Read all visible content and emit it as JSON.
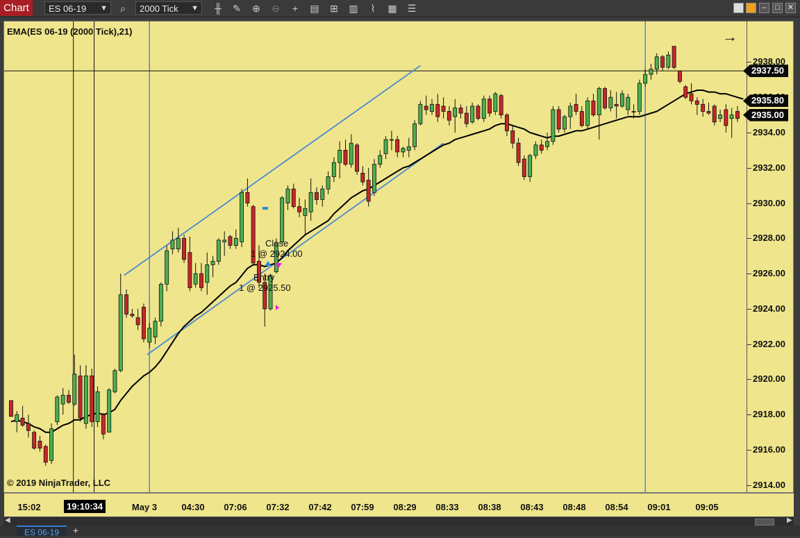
{
  "toolbar": {
    "chart_tab": "Chart",
    "instrument": "ES 06-19",
    "interval": "2000 Tick",
    "icons": [
      "search-icon",
      "bar-type-icon",
      "pencil-icon",
      "zoom-in-icon",
      "zoom-out-icon",
      "crosshair-icon",
      "properties-icon",
      "strategies-icon",
      "indicators-icon",
      "chart-trader-icon",
      "templates-icon",
      "list-icon"
    ]
  },
  "window": {
    "buttons": [
      "minimize",
      "maximize",
      "close"
    ]
  },
  "indicator_label": "EMA(ES 06-19 (2000 Tick),21)",
  "copyright": "© 2019 NinjaTrader, LLC",
  "price_markers": [
    {
      "label": "2937.50",
      "value": 2937.5
    },
    {
      "label": "2935.80",
      "value": 2935.8
    },
    {
      "label": "2935.00",
      "value": 2935.0
    }
  ],
  "annotations": {
    "close_line1": "Close",
    "close_line2": "1 @ 2924.00",
    "entry_line1": "Entry",
    "entry_line2": "1 @ 2925.50"
  },
  "bottom_tab": "ES 06-19",
  "add_tab": "+",
  "chart_data": {
    "type": "candlestick",
    "y_labels": [
      "2938.00",
      "2936.00",
      "2934.00",
      "2932.00",
      "2930.00",
      "2928.00",
      "2926.00",
      "2924.00",
      "2922.00",
      "2920.00",
      "2918.00",
      "2916.00",
      "2914.00"
    ],
    "ylim": [
      2913.6,
      2940.3
    ],
    "x_labels": [
      "15:02",
      "19:10:34",
      "May 3",
      "04:30",
      "07:06",
      "07:32",
      "07:42",
      "07:59",
      "08:29",
      "08:33",
      "08:38",
      "08:43",
      "08:48",
      "08:54",
      "09:01",
      "09:05"
    ],
    "highlighted_x_label": "19:10:34",
    "candles": [
      {
        "o": 2918.8,
        "h": 2918.8,
        "l": 2917.9,
        "c": 2917.9
      },
      {
        "o": 2917.6,
        "h": 2918.2,
        "l": 2917.0,
        "c": 2918.0
      },
      {
        "o": 2917.8,
        "h": 2918.5,
        "l": 2917.3,
        "c": 2917.4
      },
      {
        "o": 2917.5,
        "h": 2918.0,
        "l": 2916.7,
        "c": 2917.1
      },
      {
        "o": 2917.0,
        "h": 2917.1,
        "l": 2916.0,
        "c": 2916.1
      },
      {
        "o": 2916.5,
        "h": 2916.8,
        "l": 2915.9,
        "c": 2916.1
      },
      {
        "o": 2916.2,
        "h": 2916.3,
        "l": 2915.1,
        "c": 2915.3
      },
      {
        "o": 2915.4,
        "h": 2917.5,
        "l": 2915.2,
        "c": 2917.2
      },
      {
        "o": 2917.6,
        "h": 2919.1,
        "l": 2917.4,
        "c": 2919.0
      },
      {
        "o": 2918.6,
        "h": 2919.5,
        "l": 2918.0,
        "c": 2919.1
      },
      {
        "o": 2919.1,
        "h": 2919.4,
        "l": 2918.6,
        "c": 2918.7
      },
      {
        "o": 2918.6,
        "h": 2921.4,
        "l": 2918.5,
        "c": 2920.3
      },
      {
        "o": 2920.2,
        "h": 2920.8,
        "l": 2917.6,
        "c": 2917.8
      },
      {
        "o": 2917.5,
        "h": 2920.8,
        "l": 2917.2,
        "c": 2920.2
      },
      {
        "o": 2920.2,
        "h": 2920.6,
        "l": 2917.3,
        "c": 2917.6
      },
      {
        "o": 2917.6,
        "h": 2919.6,
        "l": 2917.3,
        "c": 2919.3
      },
      {
        "o": 2918.0,
        "h": 2918.1,
        "l": 2916.6,
        "c": 2916.9
      },
      {
        "o": 2917.0,
        "h": 2919.5,
        "l": 2917.0,
        "c": 2919.4
      },
      {
        "o": 2919.3,
        "h": 2920.6,
        "l": 2919.2,
        "c": 2920.5
      },
      {
        "o": 2920.5,
        "h": 2926.0,
        "l": 2920.4,
        "c": 2924.8
      },
      {
        "o": 2924.8,
        "h": 2925.1,
        "l": 2923.5,
        "c": 2923.7
      },
      {
        "o": 2923.7,
        "h": 2924.0,
        "l": 2923.5,
        "c": 2923.6
      },
      {
        "o": 2923.5,
        "h": 2924.0,
        "l": 2922.8,
        "c": 2923.1
      },
      {
        "o": 2924.1,
        "h": 2924.3,
        "l": 2922.1,
        "c": 2922.3
      },
      {
        "o": 2922.1,
        "h": 2923.2,
        "l": 2921.8,
        "c": 2922.9
      },
      {
        "o": 2922.4,
        "h": 2923.5,
        "l": 2922.0,
        "c": 2923.3
      },
      {
        "o": 2923.3,
        "h": 2925.5,
        "l": 2923.0,
        "c": 2925.4
      },
      {
        "o": 2925.4,
        "h": 2927.6,
        "l": 2925.0,
        "c": 2927.3
      },
      {
        "o": 2927.4,
        "h": 2928.4,
        "l": 2927.1,
        "c": 2927.9
      },
      {
        "o": 2927.4,
        "h": 2928.6,
        "l": 2927.2,
        "c": 2928.0
      },
      {
        "o": 2928.0,
        "h": 2928.2,
        "l": 2926.6,
        "c": 2926.8
      },
      {
        "o": 2927.2,
        "h": 2928.1,
        "l": 2925.0,
        "c": 2925.2
      },
      {
        "o": 2925.4,
        "h": 2926.6,
        "l": 2925.2,
        "c": 2926.0
      },
      {
        "o": 2926.0,
        "h": 2926.6,
        "l": 2925.0,
        "c": 2925.2
      },
      {
        "o": 2925.5,
        "h": 2927.2,
        "l": 2924.8,
        "c": 2926.5
      },
      {
        "o": 2926.5,
        "h": 2927.0,
        "l": 2925.8,
        "c": 2926.7
      },
      {
        "o": 2926.7,
        "h": 2928.0,
        "l": 2926.5,
        "c": 2927.9
      },
      {
        "o": 2927.8,
        "h": 2928.4,
        "l": 2927.0,
        "c": 2927.9
      },
      {
        "o": 2928.1,
        "h": 2928.2,
        "l": 2927.4,
        "c": 2927.6
      },
      {
        "o": 2927.6,
        "h": 2928.5,
        "l": 2927.4,
        "c": 2928.0
      },
      {
        "o": 2927.8,
        "h": 2930.8,
        "l": 2927.5,
        "c": 2930.6
      },
      {
        "o": 2930.6,
        "h": 2931.4,
        "l": 2929.8,
        "c": 2930.0
      },
      {
        "o": 2929.8,
        "h": 2929.9,
        "l": 2926.5,
        "c": 2926.6
      },
      {
        "o": 2926.7,
        "h": 2927.6,
        "l": 2925.2,
        "c": 2925.5
      },
      {
        "o": 2925.5,
        "h": 2926.0,
        "l": 2923.0,
        "c": 2924.0
      },
      {
        "o": 2924.0,
        "h": 2926.0,
        "l": 2923.9,
        "c": 2925.9
      },
      {
        "o": 2926.1,
        "h": 2928.0,
        "l": 2926.0,
        "c": 2927.7
      },
      {
        "o": 2927.8,
        "h": 2930.4,
        "l": 2927.7,
        "c": 2930.3
      },
      {
        "o": 2930.0,
        "h": 2931.0,
        "l": 2929.6,
        "c": 2930.8
      },
      {
        "o": 2930.8,
        "h": 2931.1,
        "l": 2929.7,
        "c": 2929.8
      },
      {
        "o": 2929.8,
        "h": 2930.3,
        "l": 2929.2,
        "c": 2929.5
      },
      {
        "o": 2929.3,
        "h": 2930.2,
        "l": 2928.2,
        "c": 2929.7
      },
      {
        "o": 2929.5,
        "h": 2931.4,
        "l": 2929.0,
        "c": 2930.6
      },
      {
        "o": 2930.6,
        "h": 2930.9,
        "l": 2929.9,
        "c": 2930.2
      },
      {
        "o": 2930.2,
        "h": 2931.0,
        "l": 2929.8,
        "c": 2930.8
      },
      {
        "o": 2930.8,
        "h": 2931.8,
        "l": 2930.5,
        "c": 2931.5
      },
      {
        "o": 2931.5,
        "h": 2932.6,
        "l": 2931.2,
        "c": 2932.3
      },
      {
        "o": 2932.3,
        "h": 2933.5,
        "l": 2931.4,
        "c": 2933.0
      },
      {
        "o": 2933.0,
        "h": 2933.6,
        "l": 2932.1,
        "c": 2932.2
      },
      {
        "o": 2932.2,
        "h": 2933.9,
        "l": 2932.0,
        "c": 2933.4
      },
      {
        "o": 2933.3,
        "h": 2933.4,
        "l": 2931.6,
        "c": 2931.8
      },
      {
        "o": 2931.7,
        "h": 2932.1,
        "l": 2931.0,
        "c": 2931.2
      },
      {
        "o": 2931.3,
        "h": 2932.0,
        "l": 2929.8,
        "c": 2930.1
      },
      {
        "o": 2930.6,
        "h": 2932.5,
        "l": 2930.4,
        "c": 2932.2
      },
      {
        "o": 2932.2,
        "h": 2933.0,
        "l": 2932.0,
        "c": 2932.7
      },
      {
        "o": 2932.8,
        "h": 2933.8,
        "l": 2932.5,
        "c": 2933.6
      },
      {
        "o": 2933.6,
        "h": 2934.1,
        "l": 2933.0,
        "c": 2933.6
      },
      {
        "o": 2933.6,
        "h": 2933.8,
        "l": 2932.6,
        "c": 2932.9
      },
      {
        "o": 2932.9,
        "h": 2933.2,
        "l": 2932.6,
        "c": 2933.1
      },
      {
        "o": 2933.0,
        "h": 2933.7,
        "l": 2932.6,
        "c": 2933.2
      },
      {
        "o": 2933.2,
        "h": 2934.7,
        "l": 2933.0,
        "c": 2934.5
      },
      {
        "o": 2934.5,
        "h": 2935.8,
        "l": 2934.4,
        "c": 2935.6
      },
      {
        "o": 2935.5,
        "h": 2936.1,
        "l": 2935.0,
        "c": 2935.3
      },
      {
        "o": 2935.2,
        "h": 2935.9,
        "l": 2935.0,
        "c": 2935.6
      },
      {
        "o": 2935.6,
        "h": 2936.2,
        "l": 2934.6,
        "c": 2934.9
      },
      {
        "o": 2935.5,
        "h": 2936.0,
        "l": 2934.8,
        "c": 2935.2
      },
      {
        "o": 2935.2,
        "h": 2935.5,
        "l": 2934.4,
        "c": 2934.7
      },
      {
        "o": 2934.9,
        "h": 2935.9,
        "l": 2934.0,
        "c": 2935.4
      },
      {
        "o": 2935.4,
        "h": 2935.6,
        "l": 2934.8,
        "c": 2935.1
      },
      {
        "o": 2935.1,
        "h": 2935.5,
        "l": 2934.3,
        "c": 2934.5
      },
      {
        "o": 2934.6,
        "h": 2935.7,
        "l": 2934.5,
        "c": 2935.5
      },
      {
        "o": 2935.5,
        "h": 2935.6,
        "l": 2934.7,
        "c": 2934.8
      },
      {
        "o": 2934.8,
        "h": 2936.1,
        "l": 2934.6,
        "c": 2935.9
      },
      {
        "o": 2935.9,
        "h": 2936.1,
        "l": 2934.9,
        "c": 2935.1
      },
      {
        "o": 2935.2,
        "h": 2936.3,
        "l": 2935.0,
        "c": 2936.2
      },
      {
        "o": 2936.1,
        "h": 2936.2,
        "l": 2934.8,
        "c": 2935.0
      },
      {
        "o": 2935.0,
        "h": 2935.1,
        "l": 2933.8,
        "c": 2934.1
      },
      {
        "o": 2934.1,
        "h": 2934.4,
        "l": 2933.1,
        "c": 2933.4
      },
      {
        "o": 2933.4,
        "h": 2933.7,
        "l": 2932.1,
        "c": 2932.3
      },
      {
        "o": 2932.5,
        "h": 2932.7,
        "l": 2931.3,
        "c": 2931.5
      },
      {
        "o": 2931.5,
        "h": 2932.8,
        "l": 2931.2,
        "c": 2932.7
      },
      {
        "o": 2932.7,
        "h": 2933.5,
        "l": 2932.5,
        "c": 2933.3
      },
      {
        "o": 2933.3,
        "h": 2933.6,
        "l": 2932.8,
        "c": 2933.0
      },
      {
        "o": 2933.2,
        "h": 2934.0,
        "l": 2933.0,
        "c": 2933.5
      },
      {
        "o": 2933.5,
        "h": 2935.5,
        "l": 2933.3,
        "c": 2935.3
      },
      {
        "o": 2935.3,
        "h": 2935.5,
        "l": 2934.0,
        "c": 2934.2
      },
      {
        "o": 2934.2,
        "h": 2935.0,
        "l": 2934.0,
        "c": 2934.9
      },
      {
        "o": 2934.9,
        "h": 2935.7,
        "l": 2934.2,
        "c": 2935.5
      },
      {
        "o": 2935.6,
        "h": 2936.2,
        "l": 2935.0,
        "c": 2935.2
      },
      {
        "o": 2935.2,
        "h": 2935.5,
        "l": 2934.3,
        "c": 2934.4
      },
      {
        "o": 2934.4,
        "h": 2936.0,
        "l": 2934.2,
        "c": 2935.8
      },
      {
        "o": 2935.8,
        "h": 2936.2,
        "l": 2934.9,
        "c": 2935.0
      },
      {
        "o": 2935.0,
        "h": 2936.6,
        "l": 2933.6,
        "c": 2936.5
      },
      {
        "o": 2936.5,
        "h": 2936.6,
        "l": 2935.3,
        "c": 2935.4
      },
      {
        "o": 2935.4,
        "h": 2936.4,
        "l": 2935.2,
        "c": 2936.0
      },
      {
        "o": 2935.6,
        "h": 2936.3,
        "l": 2934.8,
        "c": 2935.5
      },
      {
        "o": 2935.5,
        "h": 2936.4,
        "l": 2935.4,
        "c": 2936.2
      },
      {
        "o": 2935.3,
        "h": 2936.2,
        "l": 2935.0,
        "c": 2936.0
      },
      {
        "o": 2935.2,
        "h": 2935.6,
        "l": 2934.8,
        "c": 2935.2
      },
      {
        "o": 2935.2,
        "h": 2937.0,
        "l": 2935.0,
        "c": 2936.8
      },
      {
        "o": 2936.8,
        "h": 2937.6,
        "l": 2936.6,
        "c": 2937.3
      },
      {
        "o": 2937.3,
        "h": 2937.9,
        "l": 2937.0,
        "c": 2937.6
      },
      {
        "o": 2937.6,
        "h": 2938.5,
        "l": 2937.3,
        "c": 2938.3
      },
      {
        "o": 2938.3,
        "h": 2938.4,
        "l": 2937.5,
        "c": 2937.7
      },
      {
        "o": 2937.7,
        "h": 2938.6,
        "l": 2937.6,
        "c": 2938.4
      },
      {
        "o": 2938.9,
        "h": 2938.9,
        "l": 2937.6,
        "c": 2937.7
      },
      {
        "o": 2937.5,
        "h": 2937.5,
        "l": 2936.8,
        "c": 2936.9
      },
      {
        "o": 2936.6,
        "h": 2936.7,
        "l": 2935.9,
        "c": 2936.0
      },
      {
        "o": 2936.2,
        "h": 2936.8,
        "l": 2935.6,
        "c": 2935.8
      },
      {
        "o": 2935.8,
        "h": 2936.0,
        "l": 2935.0,
        "c": 2935.6
      },
      {
        "o": 2935.6,
        "h": 2935.9,
        "l": 2934.9,
        "c": 2935.2
      },
      {
        "o": 2935.2,
        "h": 2935.7,
        "l": 2935.0,
        "c": 2935.1
      },
      {
        "o": 2935.5,
        "h": 2935.6,
        "l": 2934.4,
        "c": 2934.6
      },
      {
        "o": 2934.8,
        "h": 2935.3,
        "l": 2934.6,
        "c": 2935.0
      },
      {
        "o": 2935.3,
        "h": 2935.6,
        "l": 2934.0,
        "c": 2934.4
      },
      {
        "o": 2934.8,
        "h": 2935.4,
        "l": 2933.7,
        "c": 2935.0
      },
      {
        "o": 2935.2,
        "h": 2935.5,
        "l": 2934.6,
        "c": 2934.8
      }
    ],
    "ema": [
      2917.6,
      2917.7,
      2917.6,
      2917.5,
      2917.3,
      2917.2,
      2917.0,
      2917.0,
      2917.2,
      2917.4,
      2917.5,
      2917.7,
      2917.7,
      2917.9,
      2918.0,
      2918.1,
      2918.0,
      2918.1,
      2918.3,
      2918.8,
      2919.2,
      2919.6,
      2919.9,
      2920.2,
      2920.4,
      2920.7,
      2921.1,
      2921.6,
      2922.1,
      2922.6,
      2923.0,
      2923.3,
      2923.6,
      2923.8,
      2924.1,
      2924.4,
      2924.7,
      2925.0,
      2925.3,
      2925.5,
      2925.9,
      2926.3,
      2926.5,
      2926.5,
      2926.4,
      2926.5,
      2926.6,
      2926.9,
      2927.3,
      2927.6,
      2927.9,
      2928.2,
      2928.4,
      2928.6,
      2928.8,
      2929.0,
      2929.4,
      2929.7,
      2930.0,
      2930.3,
      2930.5,
      2930.7,
      2930.8,
      2931.0,
      2931.2,
      2931.4,
      2931.6,
      2931.8,
      2932.0,
      2932.1,
      2932.3,
      2932.5,
      2932.7,
      2932.9,
      2933.1,
      2933.3,
      2933.4,
      2933.6,
      2933.7,
      2933.8,
      2933.9,
      2934.0,
      2934.1,
      2934.2,
      2934.4,
      2934.5,
      2934.5,
      2934.4,
      2934.3,
      2934.2,
      2934.0,
      2933.9,
      2933.8,
      2933.7,
      2933.8,
      2933.8,
      2933.9,
      2934.0,
      2934.1,
      2934.1,
      2934.2,
      2934.3,
      2934.4,
      2934.5,
      2934.6,
      2934.7,
      2934.8,
      2934.9,
      2934.9,
      2934.9,
      2935.0,
      2935.1,
      2935.2,
      2935.4,
      2935.6,
      2935.8,
      2936.0,
      2936.2,
      2936.3,
      2936.4,
      2936.4,
      2936.3,
      2936.3,
      2936.2,
      2936.2,
      2936.1,
      2936.0,
      2935.9
    ],
    "trend_lines": [
      {
        "p1": {
          "bar": 19.6,
          "price": 2925.9
        },
        "p2": {
          "bar": 71.0,
          "price": 2937.8
        }
      },
      {
        "p1": {
          "bar": 23.6,
          "price": 2921.4
        },
        "p2": {
          "bar": 75.0,
          "price": 2933.4
        }
      }
    ],
    "vertical_lines": [
      {
        "bar": 10.8,
        "color": "#111"
      },
      {
        "bar": 14.4,
        "color": "#111"
      },
      {
        "bar": 24.0,
        "color": "#4a8bd4"
      },
      {
        "bar": 110.0,
        "color": "#4a8bd4"
      }
    ],
    "horizontal_line": 2937.5,
    "colors": {
      "up": "#4caf50",
      "down": "#c62828",
      "ema": "#000000",
      "trend": "#4a8bd4",
      "background": "#efe58c"
    }
  }
}
